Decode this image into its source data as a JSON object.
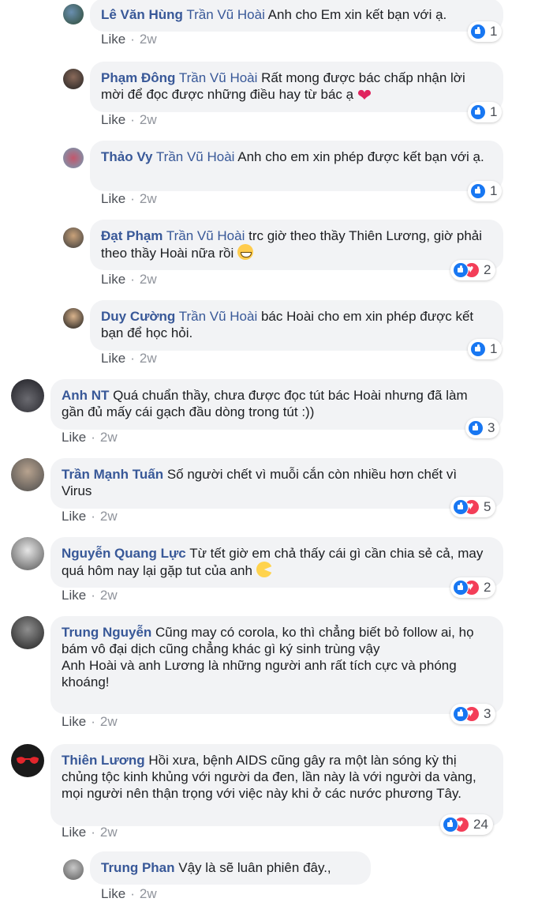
{
  "colors": {
    "author": "#385898",
    "meta": "#90949c",
    "bubble": "#f2f3f5",
    "like_blue": "#1877f2",
    "love_red": "#f33e58"
  },
  "comments": [
    {
      "author": "Lê Văn Hùng",
      "mention": "Trần Vũ Hoài",
      "text": "Anh cho Em xin kết bạn với ạ.",
      "like": "Like",
      "time": "2w",
      "reactions": "1"
    },
    {
      "author": "Phạm Đông",
      "mention": "Trần Vũ Hoài",
      "text": "Rất mong được bác chấp nhận lời mời để đọc được những điều hay từ bác ạ",
      "like": "Like",
      "time": "2w",
      "reactions": "1"
    },
    {
      "author": "Thảo Vy",
      "mention": "Trần Vũ Hoài",
      "text": "Anh cho em xin phép được kết bạn với ạ.",
      "like": "Like",
      "time": "2w",
      "reactions": "1"
    },
    {
      "author": "Đạt Phạm",
      "mention": "Trần Vũ Hoài",
      "text": "trc giờ theo thầy Thiên Lương, giờ phải theo thầy Hoài nữa rồi",
      "like": "Like",
      "time": "2w",
      "reactions": "2"
    },
    {
      "author": "Duy Cường",
      "mention": "Trần Vũ Hoài",
      "text": "bác Hoài cho em xin phép được kết bạn để học hỏi.",
      "like": "Like",
      "time": "2w",
      "reactions": "1"
    },
    {
      "author": "Anh NT",
      "text": "Quá chuẩn thầy, chưa được đọc tút bác Hoài nhưng đã làm gần đủ mấy cái gạch đầu dòng trong tút :))",
      "like": "Like",
      "time": "2w",
      "reactions": "3"
    },
    {
      "author": "Trần Mạnh Tuấn",
      "text": "Số người chết vì muỗi cắn còn nhiều hơn chết vì Virus",
      "like": "Like",
      "time": "2w",
      "reactions": "5"
    },
    {
      "author": "Nguyễn Quang Lực",
      "text": "Từ tết giờ em chả thấy cái gì cần chia sẻ cả, may quá hôm nay lại gặp tut của anh",
      "like": "Like",
      "time": "2w",
      "reactions": "2"
    },
    {
      "author": "Trung Nguyễn",
      "text": "Cũng may có corola, ko thì chẳng biết bỏ follow ai, họ bám vô đại dịch cũng chẳng khác gì ký sinh trùng vậy",
      "text2": "Anh Hoài và anh Lương là những người anh rất tích cực và phóng khoáng!",
      "like": "Like",
      "time": "2w",
      "reactions": "3"
    },
    {
      "author": "Thiên Lương",
      "text": "Hồi xưa, bệnh AIDS cũng gây ra một làn sóng kỳ thị chủng tộc kinh khủng với người da đen, lần này là với người da vàng, mọi người nên thận trọng với việc này khi ở các nước phương Tây.",
      "like": "Like",
      "time": "2w",
      "reactions": "24"
    },
    {
      "author": "Trung Phan",
      "text": "Vậy là sẽ luân phiên đây.,",
      "like": "Like",
      "time": "2w"
    }
  ]
}
